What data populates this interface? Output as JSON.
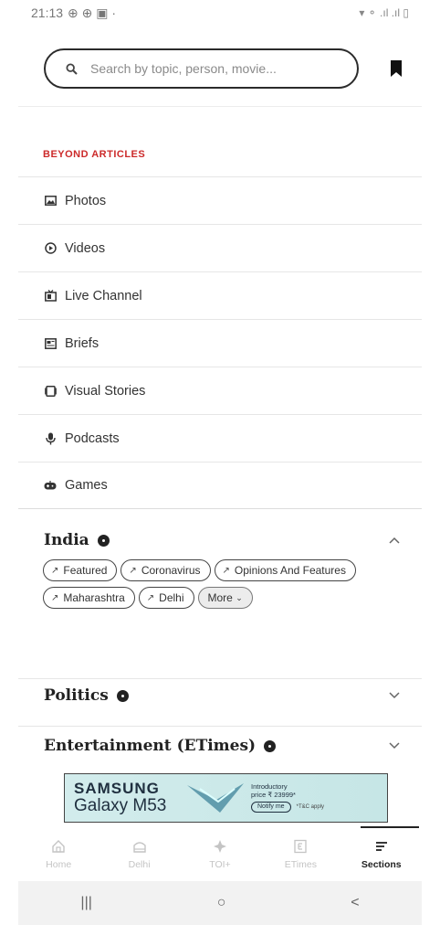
{
  "status_bar": {
    "time": "21:13",
    "indicators": "⊕ ⊕ ▣ ·",
    "right": "▾ ⚬ .ıl .ıl ▯"
  },
  "search": {
    "placeholder": "Search by topic, person, movie..."
  },
  "beyond_articles": {
    "title": "BEYOND ARTICLES",
    "items": [
      {
        "label": "Photos",
        "icon": "photo-icon"
      },
      {
        "label": "Videos",
        "icon": "play-icon"
      },
      {
        "label": "Live Channel",
        "icon": "tv-icon"
      },
      {
        "label": "Briefs",
        "icon": "briefs-icon"
      },
      {
        "label": "Visual Stories",
        "icon": "stories-icon"
      },
      {
        "label": "Podcasts",
        "icon": "podcast-icon"
      },
      {
        "label": "Games",
        "icon": "games-icon"
      }
    ]
  },
  "sections": {
    "india": {
      "title": "India",
      "expanded": true,
      "chips": [
        "Featured",
        "Coronavirus",
        "Opinions And Features",
        "Maharashtra",
        "Delhi"
      ],
      "more": "More"
    },
    "politics": {
      "title": "Politics",
      "expanded": false
    },
    "entertainment": {
      "title": "Entertainment (ETimes)",
      "expanded": false
    }
  },
  "ad": {
    "brand": "SAMSUNG",
    "model": "Galaxy M53",
    "line1": "Introductory",
    "line2": "price ₹ 23999*",
    "button": "Notify me",
    "fine": "*T&C apply"
  },
  "bottom_nav": {
    "items": [
      {
        "label": "Home",
        "icon": "home-icon"
      },
      {
        "label": "Delhi",
        "icon": "city-icon"
      },
      {
        "label": "TOI+",
        "icon": "toi-plus-icon"
      },
      {
        "label": "ETimes",
        "icon": "etimes-icon"
      },
      {
        "label": "Sections",
        "icon": "sections-icon",
        "active": true
      }
    ]
  },
  "android_nav": {
    "recent": "|||",
    "home": "○",
    "back": "<"
  },
  "colors": {
    "accent_red": "#cc2a2a",
    "text_dark": "#222222",
    "nav_inactive": "#c4c4c4"
  }
}
